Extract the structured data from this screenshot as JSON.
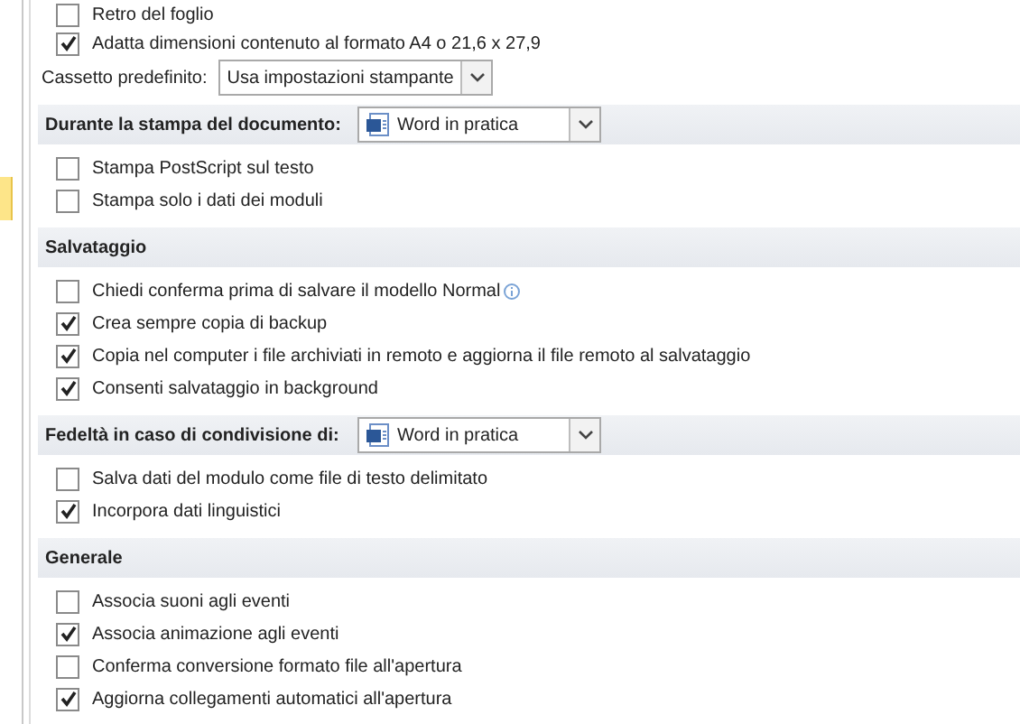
{
  "sections": [
    {
      "items": [
        {
          "kind": "checkbox",
          "label": "Retro del foglio",
          "checked": false
        },
        {
          "kind": "checkbox",
          "label": "Adatta dimensioni contenuto al formato A4 o 21,6 x 27,9",
          "checked": true
        },
        {
          "kind": "select",
          "label": "Cassetto predefinito:",
          "value": "Usa impostazioni stampante"
        }
      ]
    },
    {
      "title": "Durante la stampa del documento:",
      "document": "Word in pratica",
      "items": [
        {
          "kind": "checkbox",
          "label": "Stampa PostScript sul testo",
          "checked": false
        },
        {
          "kind": "checkbox",
          "label": "Stampa solo i dati dei moduli",
          "checked": false
        }
      ]
    },
    {
      "title": "Salvataggio",
      "items": [
        {
          "kind": "checkbox",
          "label": "Chiedi conferma prima di salvare il modello Normal",
          "checked": false,
          "info": true
        },
        {
          "kind": "checkbox",
          "label": "Crea sempre copia di backup",
          "checked": true
        },
        {
          "kind": "checkbox",
          "label": "Copia nel computer i file archiviati in remoto e aggiorna il file remoto al salvataggio",
          "checked": true
        },
        {
          "kind": "checkbox",
          "label": "Consenti salvataggio in background",
          "checked": true
        }
      ]
    },
    {
      "title": "Fedeltà in caso di condivisione di:",
      "document": "Word in pratica",
      "items": [
        {
          "kind": "checkbox",
          "label": "Salva dati del modulo come file di testo delimitato",
          "checked": false
        },
        {
          "kind": "checkbox",
          "label": "Incorpora dati linguistici",
          "checked": true
        }
      ]
    },
    {
      "title": "Generale",
      "items": [
        {
          "kind": "checkbox",
          "label": "Associa suoni agli eventi",
          "checked": false
        },
        {
          "kind": "checkbox",
          "label": "Associa animazione agli eventi",
          "checked": true
        },
        {
          "kind": "checkbox",
          "label": "Conferma conversione formato file all'apertura",
          "checked": false
        },
        {
          "kind": "checkbox",
          "label": "Aggiorna collegamenti automatici all'apertura",
          "checked": true
        }
      ]
    }
  ]
}
